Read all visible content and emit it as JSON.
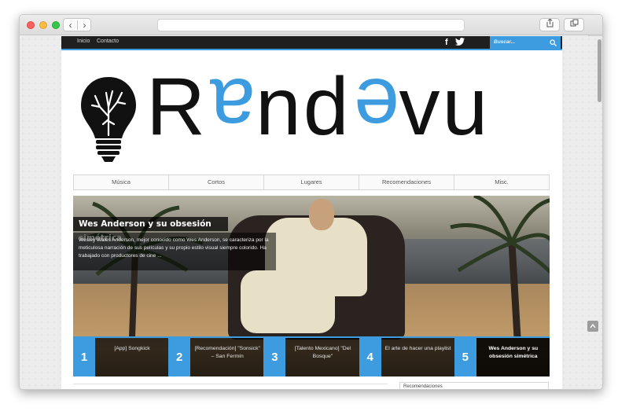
{
  "browser": {
    "back_icon": "‹",
    "forward_icon": "›",
    "share_icon": "share-icon",
    "tabs_icon": "tabs-icon",
    "new_tab": "+"
  },
  "site": {
    "top_links": [
      "Inicio",
      "Contacto"
    ],
    "social": {
      "facebook": "f",
      "twitter": "twitter-icon"
    },
    "search_placeholder": "Buscar...",
    "logo": {
      "prefix": "R",
      "flipped_1": "a",
      "middle": "nd",
      "flipped_2": "e",
      "suffix": "vu"
    },
    "menu": [
      "Música",
      "Cortos",
      "Lugares",
      "Recomendaciones",
      "Misc."
    ],
    "hero": {
      "title": "Wes Anderson y su obsesión simétrica",
      "excerpt": "Wesley Wales Anderson, mejor conocido como Wes Anderson, se caracteriza por la meticulosa narración de sus películas y su propio estilo visual siempre colorido. Ha trabajado con productores de cine ..."
    },
    "slides": [
      {
        "num": "1",
        "text": "[App] Songkick"
      },
      {
        "num": "2",
        "text": "[Recomendación] \"Sonsick\" – San Fermín"
      },
      {
        "num": "3",
        "text": "[Talento Mexicano] \"Del Bosque\""
      },
      {
        "num": "4",
        "text": "El arte de hacer una playlist"
      },
      {
        "num": "5",
        "text": "Wes Anderson y su obsesión simétrica"
      }
    ],
    "sidebar_heading": "Recomendaciones",
    "colors": {
      "accent": "#3d9be0",
      "topbar": "#1f1f1f"
    }
  }
}
